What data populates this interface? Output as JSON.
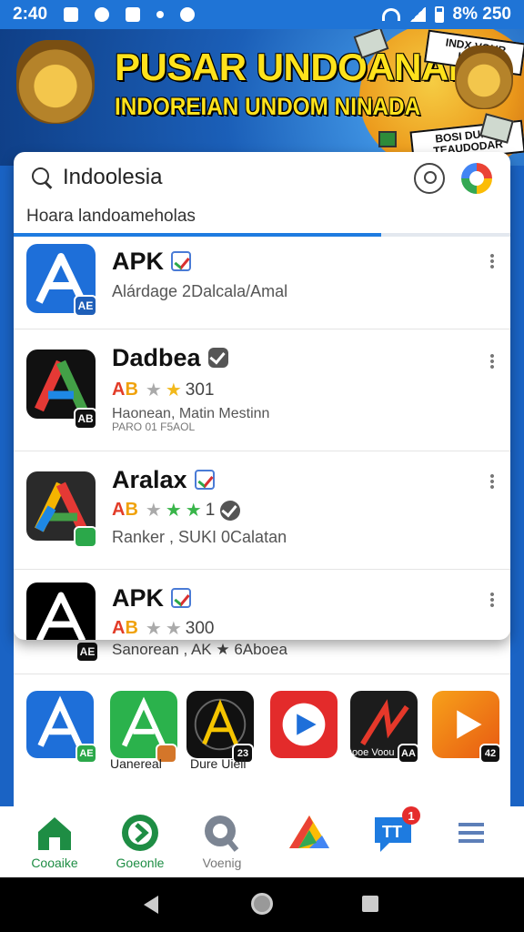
{
  "status_bar": {
    "time": "2:40",
    "battery_text": "8% 250"
  },
  "banner": {
    "title": "PUSAR UNDOANAIA",
    "subtitle": "INDOREIAN UNDOM NINADA",
    "sticker_top": "INDX VOUR HULIX",
    "sticker_bottom": "BOSI DUMM TEAUDODAR"
  },
  "search": {
    "query": "Indoolesia",
    "suggestion": "Hoara landoameholas",
    "progress_pct": 74
  },
  "results": [
    {
      "name": "APK",
      "sub": "Alárdage 2Dalcala/Amal",
      "badge": "AE",
      "rating": null,
      "verify": "check"
    },
    {
      "name": "Dadbea",
      "ab": "AB",
      "stars": [
        "off",
        "on"
      ],
      "rating_text": "301",
      "sub": "Haonean, Matin Mestinn",
      "sub2": "PARO 01 F5AOL",
      "badge": "AB",
      "verify": "gray"
    },
    {
      "name": "Aralax",
      "ab": "AB",
      "stars": [
        "off",
        "green",
        "green"
      ],
      "rating_text": "1",
      "sub": "Ranker , SUKI 0Calatan",
      "badge": "",
      "verify": "check"
    },
    {
      "name": "APK",
      "ab": "AB",
      "stars": [
        "off",
        "off"
      ],
      "rating_text": "300",
      "sub": "",
      "badge": "AE",
      "verify": "check"
    }
  ],
  "behind_list": {
    "line": "Sanorean , AK ★ 6Aboea",
    "grid": [
      {
        "badge": "AE",
        "label": ""
      },
      {
        "badge": "",
        "label": "Uanereal"
      },
      {
        "badge": "23",
        "label": "Dure Uiell"
      },
      {
        "badge": "",
        "label": ""
      },
      {
        "badge": "AA",
        "label": "Dooe Voou"
      },
      {
        "badge": "42",
        "label": ""
      }
    ]
  },
  "bottom_nav": [
    {
      "label": "Cooaike",
      "icon": "home-icon"
    },
    {
      "label": "Goeonle",
      "icon": "share-icon"
    },
    {
      "label": "Voenig",
      "icon": "search-icon"
    },
    {
      "label": "",
      "icon": "drive-icon"
    },
    {
      "label": "",
      "icon": "chat-icon",
      "badge": "1"
    },
    {
      "label": "",
      "icon": "menu-icon"
    }
  ],
  "colors": {
    "accent": "#1e7be0",
    "nav_active": "#1e8d44",
    "banner_text": "#ffe21c"
  }
}
